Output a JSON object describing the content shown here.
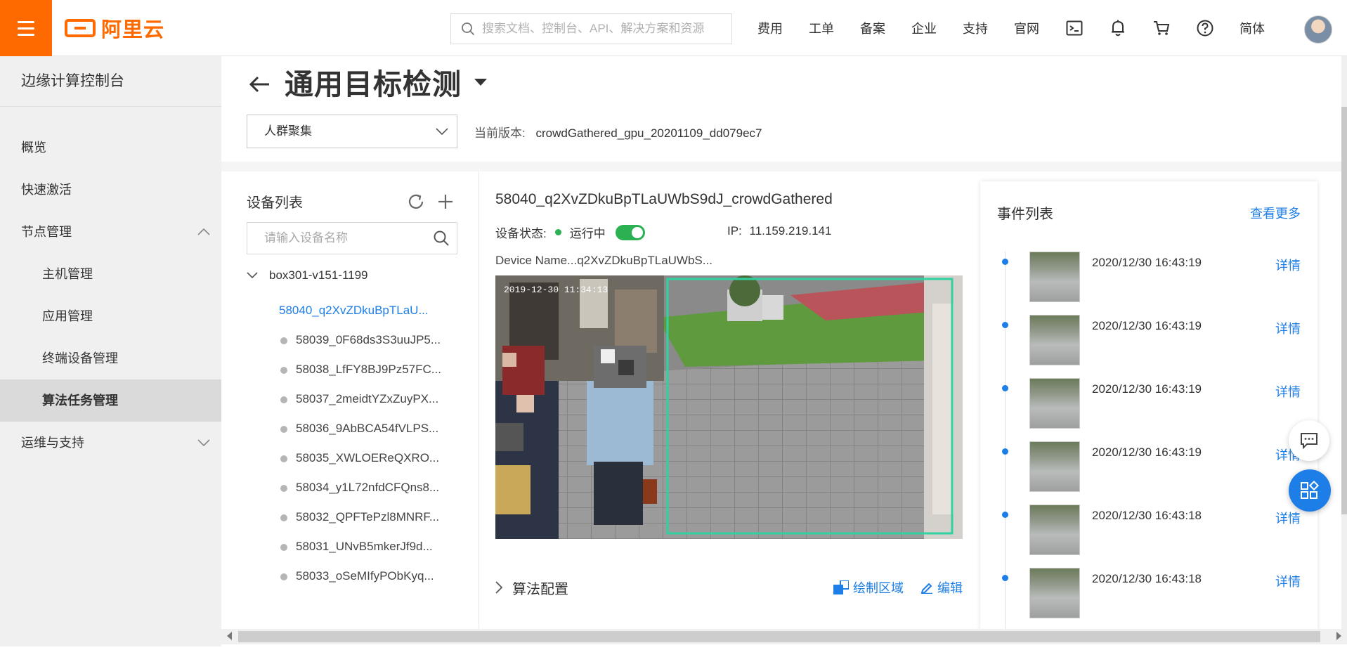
{
  "topbar": {
    "logo_text": "阿里云",
    "search_placeholder": "搜索文档、控制台、API、解决方案和资源",
    "nav": [
      "费用",
      "工单",
      "备案",
      "企业",
      "支持",
      "官网"
    ],
    "icons": [
      "terminal-icon",
      "bell-icon",
      "cart-icon",
      "help-icon"
    ],
    "language": "简体"
  },
  "sidebar": {
    "title": "边缘计算控制台",
    "items": [
      {
        "label": "概览"
      },
      {
        "label": "快速激活"
      },
      {
        "label": "节点管理"
      },
      {
        "label": "主机管理"
      },
      {
        "label": "应用管理"
      },
      {
        "label": "终端设备管理"
      },
      {
        "label": "算法任务管理"
      },
      {
        "label": "运维与支持"
      }
    ]
  },
  "header": {
    "title": "通用目标检测",
    "algorithm_selected": "人群聚集",
    "version_label": "当前版本:",
    "version_value": "crowdGathered_gpu_20201109_dd079ec7"
  },
  "device_list": {
    "title": "设备列表",
    "search_placeholder": "请输入设备名称",
    "root": "box301-v151-1199",
    "items": [
      "58040_q2XvZDkuBpTLaU...",
      "58039_0F68ds3S3uuJP5...",
      "58038_LfFY8BJ9Pz57FC...",
      "58037_2meidtYZxZuyPX...",
      "58036_9AbBCA54fVLPS...",
      "58035_XWLOEReQXRO...",
      "58034_y1L72nfdCFQns8...",
      "58032_QPFTePzl8MNRF...",
      "58031_UNvB5mkerJf9d...",
      "58033_oSeMIfyPObKyq..."
    ]
  },
  "detail": {
    "device_name": "58040_q2XvZDkuBpTLaUWbS9dJ_crowdGathered",
    "status_label": "设备状态:",
    "status_value": "运行中",
    "ip_label": "IP:",
    "ip_value": "11.159.219.141",
    "device_desc": "Device Name...q2XvZDkuBpTLaUWbS...",
    "video_timestamp": "2019-12-30 11:34:13",
    "config_label": "算法配置",
    "draw_region": "绘制区域",
    "edit": "编辑"
  },
  "events": {
    "title": "事件列表",
    "more": "查看更多",
    "detail_label": "详情",
    "items": [
      {
        "time": "2020/12/30 16:43:19"
      },
      {
        "time": "2020/12/30 16:43:19"
      },
      {
        "time": "2020/12/30 16:43:19"
      },
      {
        "time": "2020/12/30 16:43:19"
      },
      {
        "time": "2020/12/30 16:43:18"
      },
      {
        "time": "2020/12/30 16:43:18"
      }
    ]
  },
  "colors": {
    "brand_orange": "#ff6a00",
    "link_blue": "#1c7ee6",
    "status_green": "#2bb151",
    "detection_box": "#2fd2a0"
  }
}
